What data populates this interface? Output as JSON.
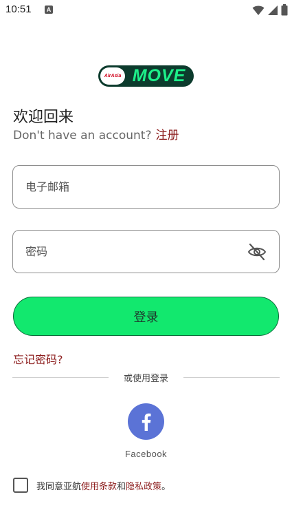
{
  "status_bar": {
    "time": "10:51",
    "notification_glyph": "A",
    "icons": [
      "wifi-icon",
      "cell-signal-icon",
      "battery-icon"
    ]
  },
  "logo": {
    "badge_text": "AirAsia",
    "word": "MOVE"
  },
  "header": {
    "welcome": "欢迎回来",
    "no_account": "Don't have an account?",
    "register": "注册"
  },
  "form": {
    "email_placeholder": "电子邮箱",
    "password_placeholder": "密码",
    "login_label": "登录",
    "forgot_password": "忘记密码?"
  },
  "social": {
    "divider": "或使用登录",
    "facebook_label": "Facebook"
  },
  "terms": {
    "prefix": "我同意亚航",
    "terms_link": "使用条款",
    "and": "和",
    "privacy_link": "隐私政策",
    "suffix": "。"
  },
  "colors": {
    "accent_green": "#12e86e",
    "link_red": "#8b1a1a",
    "facebook_blue": "#5b73d6",
    "logo_dark": "#0c3b2d"
  }
}
